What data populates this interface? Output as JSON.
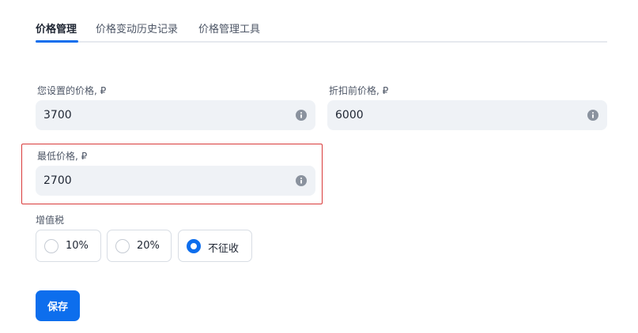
{
  "tabs": [
    {
      "label": "价格管理",
      "active": true
    },
    {
      "label": "价格变动历史记录",
      "active": false
    },
    {
      "label": "价格管理工具",
      "active": false
    }
  ],
  "fields": {
    "your_price": {
      "label": "您设置的价格, ₽",
      "value": "3700"
    },
    "price_before_discount": {
      "label": "折扣前价格, ₽",
      "value": "6000"
    },
    "min_price": {
      "label": "最低价格, ₽",
      "value": "2700"
    }
  },
  "vat": {
    "label": "增值税",
    "options": [
      {
        "label": "10%",
        "checked": false
      },
      {
        "label": "20%",
        "checked": false
      },
      {
        "label": "不征收",
        "checked": true
      }
    ]
  },
  "save_label": "保存",
  "colors": {
    "accent": "#0d6eed",
    "field_bg": "#eff2f6",
    "highlight_border": "#d93a3a"
  }
}
